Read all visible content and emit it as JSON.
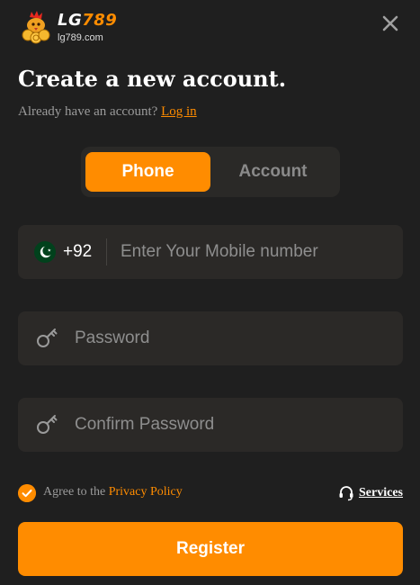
{
  "header": {
    "brand_prefix": "LG",
    "brand_number": "789",
    "domain": "lg789.com",
    "logo_icon": "rooster-coin-logo",
    "close_icon": "close-icon"
  },
  "title": "Create a new account.",
  "login_prompt": {
    "text": "Already have an account?",
    "link": "Log in"
  },
  "tabs": {
    "active": "Phone",
    "inactive": "Account"
  },
  "phone": {
    "flag_icon": "pakistan-flag-icon",
    "country_code": "+92",
    "value": "",
    "placeholder": "Enter Your Mobile number"
  },
  "password": {
    "icon": "key-icon",
    "value": "",
    "placeholder": "Password"
  },
  "confirm_password": {
    "icon": "key-icon",
    "value": "",
    "placeholder": "Confirm Password"
  },
  "agree": {
    "checked": true,
    "text": "Agree to the",
    "link": "Privacy Policy"
  },
  "services": {
    "icon": "headset-icon",
    "label": "Services"
  },
  "register_label": "Register",
  "colors": {
    "background": "#1f1f1f",
    "accent": "#ff8c00",
    "field_bg": "#2b2927",
    "muted_text": "#9b9b9b"
  }
}
